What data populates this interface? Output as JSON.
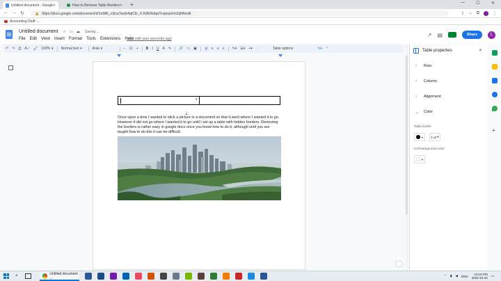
{
  "browser": {
    "tabs": [
      {
        "title": "Untitled document - Google Docs",
        "active": true
      },
      {
        "title": "How to Remove Table Borders in",
        "active": false
      }
    ],
    "url": "https://docs.google.com/document/d/1mM6_n3icaTwdxi4qICIir_X-N3ERdqwTcvjwcpUm2qlfA/edit",
    "bookmark": "Accounting Stuff -...",
    "window_controls": {
      "minimize": "—",
      "maximize": "☐",
      "close": "✕"
    }
  },
  "docs": {
    "title": "Untitled document",
    "status": "Saving...",
    "menu": [
      "File",
      "Edit",
      "View",
      "Insert",
      "Format",
      "Tools",
      "Extensions",
      "Help"
    ],
    "last_edit": "Last edit was seconds ago",
    "share_label": "Share",
    "avatar_letter": "L"
  },
  "toolbar": {
    "zoom": "100%",
    "style": "Normal text",
    "font": "Arial",
    "size": "11",
    "minus": "−",
    "plus": "+",
    "bold": "B",
    "italic": "I",
    "underline": "U",
    "table_options": "Table options"
  },
  "document": {
    "paragraph": "Once upon a time I wanted to stick a picture in a document so that it went where I wanted it to go.  However it did not go where I wanted it to go until I set up a table with hidden borders. Removing the borders is rather easy in google docs once you know how to do it, although until you are taught how to do this it can be difficult."
  },
  "side_panel": {
    "title": "Table properties",
    "sections": [
      {
        "label": "Row",
        "expanded": false
      },
      {
        "label": "Column",
        "expanded": false
      },
      {
        "label": "Alignment",
        "expanded": false
      },
      {
        "label": "Color",
        "expanded": true
      }
    ],
    "table_border_label": "Table border",
    "border_width": "1 pt",
    "cell_bg_label": "Cell background color"
  },
  "taskbar": {
    "chrome_label": "Untitled document ...",
    "lang": "ENG",
    "time": "10:10 PM",
    "date": "2022-10-23"
  },
  "colors": {
    "accent": "#1a73e8",
    "docs_blue": "#4285f4",
    "toolbar_bg": "#edf2fa"
  }
}
